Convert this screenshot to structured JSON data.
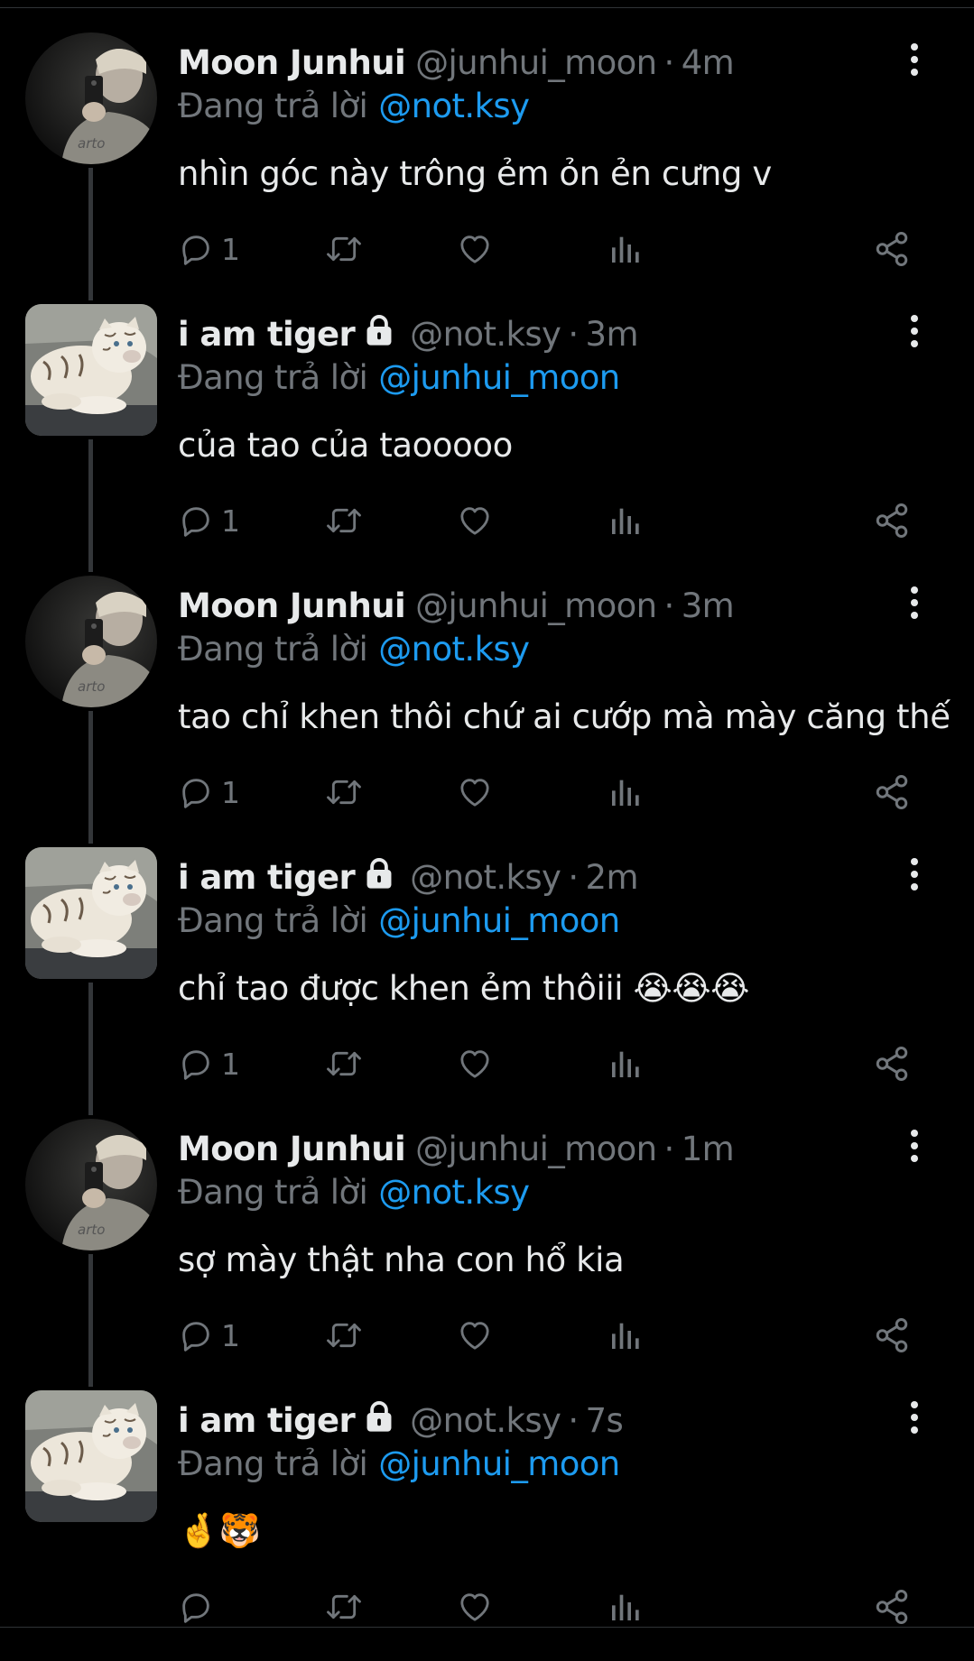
{
  "colors": {
    "background": "#000000",
    "text": "#e7e9ea",
    "muted": "#71767b",
    "link": "#1d9bf0",
    "thread_line": "#333639"
  },
  "tweets": [
    {
      "display_name": "Moon Junhui",
      "handle": "@junhui_moon",
      "time": "4m",
      "reply_prefix": "Đang trả lời",
      "reply_to": "@not.ksy",
      "text": "nhìn góc này trông ẻm ỏn ẻn cưng v",
      "reply_count": "1",
      "locked": false,
      "avatar": "person-selfie-avatar"
    },
    {
      "display_name": "i am tiger",
      "handle": "@not.ksy",
      "time": "3m",
      "reply_prefix": "Đang trả lời",
      "reply_to": "@junhui_moon",
      "text": "của tao của taooooo",
      "reply_count": "1",
      "locked": true,
      "avatar": "white-tiger-avatar"
    },
    {
      "display_name": "Moon Junhui",
      "handle": "@junhui_moon",
      "time": "3m",
      "reply_prefix": "Đang trả lời",
      "reply_to": "@not.ksy",
      "text": "tao chỉ khen thôi chứ ai cướp mà mày căng thế",
      "reply_count": "1",
      "locked": false,
      "avatar": "person-selfie-avatar"
    },
    {
      "display_name": "i am tiger",
      "handle": "@not.ksy",
      "time": "2m",
      "reply_prefix": "Đang trả lời",
      "reply_to": "@junhui_moon",
      "text": "chỉ tao được khen ẻm thôiii 😭😭😭",
      "reply_count": "1",
      "locked": true,
      "avatar": "white-tiger-avatar"
    },
    {
      "display_name": "Moon Junhui",
      "handle": "@junhui_moon",
      "time": "1m",
      "reply_prefix": "Đang trả lời",
      "reply_to": "@not.ksy",
      "text": "sợ mày thật nha con hổ kia",
      "reply_count": "1",
      "locked": false,
      "avatar": "person-selfie-avatar"
    },
    {
      "display_name": "i am tiger",
      "handle": "@not.ksy",
      "time": "7s",
      "reply_prefix": "Đang trả lời",
      "reply_to": "@junhui_moon",
      "text": "🤞🐯",
      "reply_count": "",
      "locked": true,
      "avatar": "white-tiger-avatar"
    }
  ],
  "icons": {
    "reply": "reply-icon",
    "retweet": "retweet-icon",
    "like": "heart-icon",
    "views": "views-icon",
    "share": "share-icon",
    "more": "more-options-icon",
    "lock": "lock-icon"
  }
}
